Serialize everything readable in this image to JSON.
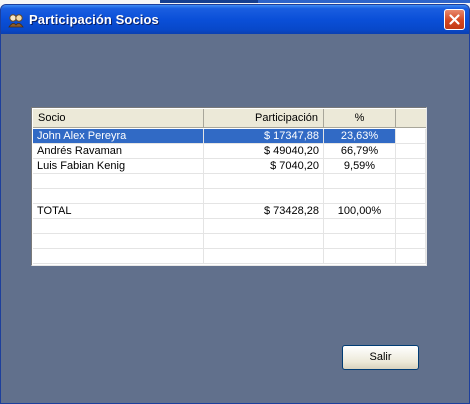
{
  "window": {
    "title": "Participación Socios",
    "colors": {
      "titlebar": "#0a4fd8",
      "client": "#61708c",
      "selection": "#316ac5",
      "close": "#d4461f"
    }
  },
  "grid": {
    "columns": [
      "Socio",
      "Participación",
      "%"
    ],
    "rows": [
      {
        "socio": "John Alex Pereyra",
        "participacion": "$ 17347,88",
        "porcentaje": "23,63%",
        "selected": true
      },
      {
        "socio": "Andrés Ravaman",
        "participacion": "$ 49040,20",
        "porcentaje": "66,79%"
      },
      {
        "socio": "Luis Fabian Kenig",
        "participacion": "$ 7040,20",
        "porcentaje": "9,59%"
      },
      {
        "socio": "",
        "participacion": "",
        "porcentaje": ""
      },
      {
        "socio": "",
        "participacion": "",
        "porcentaje": ""
      },
      {
        "socio": "TOTAL",
        "participacion": "$ 73428,28",
        "porcentaje": "100,00%"
      },
      {
        "socio": "",
        "participacion": "",
        "porcentaje": ""
      },
      {
        "socio": "",
        "participacion": "",
        "porcentaje": ""
      },
      {
        "socio": "",
        "participacion": "",
        "porcentaje": ""
      }
    ]
  },
  "buttons": {
    "salir": "Salir"
  },
  "icons": {
    "title": "app-icon",
    "close": "close-icon"
  }
}
